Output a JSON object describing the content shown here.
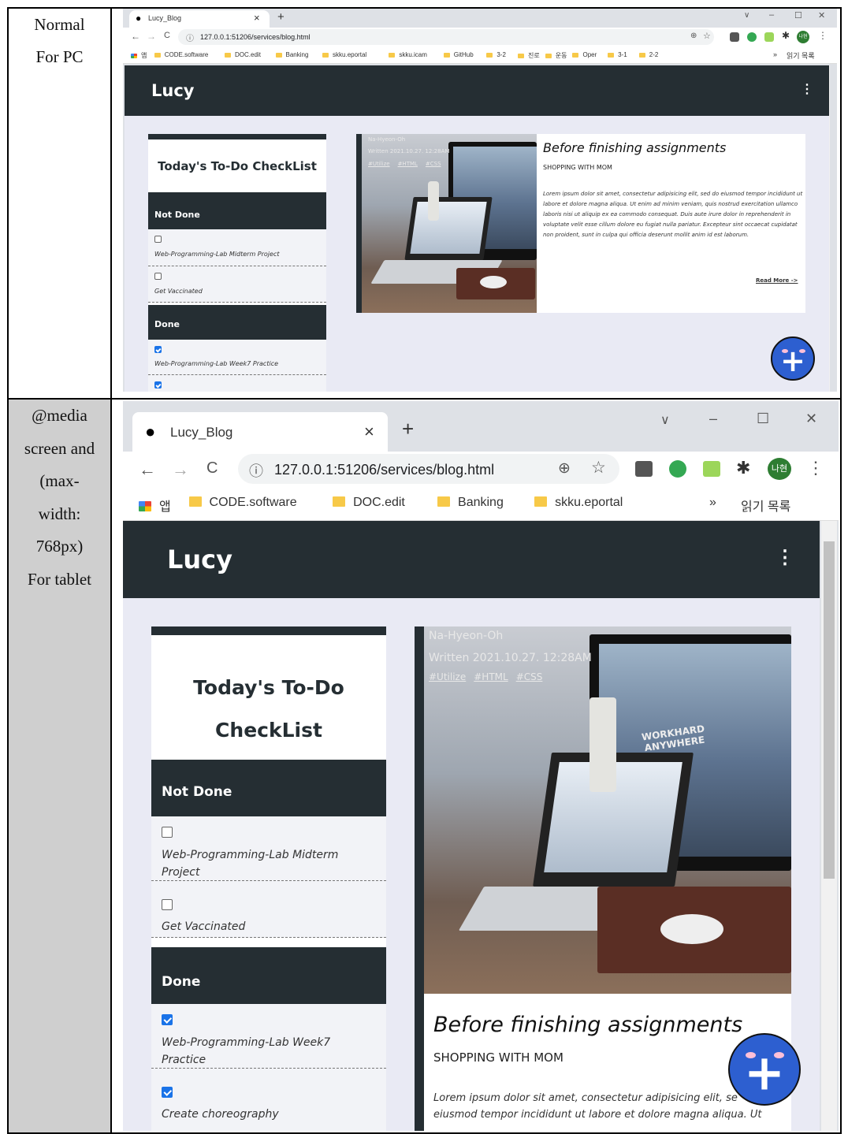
{
  "rows": [
    {
      "label_lines": [
        "Normal",
        "For PC"
      ]
    },
    {
      "label_lines": [
        "@media",
        "screen and",
        "(max-",
        "width:",
        "768px)",
        "For tablet"
      ]
    }
  ],
  "browser": {
    "tab_title": "Lucy_Blog",
    "tab_close": "×",
    "new_tab": "+",
    "controls": {
      "dropdown": "∨",
      "minimize": "–",
      "maximize": "☐",
      "close": "✕"
    },
    "nav": {
      "back": "←",
      "forward": "→",
      "reload": "C",
      "info": "ⓘ"
    },
    "url": "127.0.0.1:51206/services/blog.html",
    "zoom_icon": "⊕",
    "star_icon": "☆",
    "puzzle_icon": "✱",
    "menu_icon": "⋮",
    "profile": "나현",
    "bookmarks_pc": [
      "앱",
      "CODE.software",
      "DOC.edit",
      "Banking",
      "skku.eportal",
      "skku.icam",
      "GitHub",
      "3-2",
      "진로",
      "운동",
      "Oper",
      "3-1",
      "2-2"
    ],
    "bookmarks_tablet": [
      "앱",
      "CODE.software",
      "DOC.edit",
      "Banking",
      "skku.eportal"
    ],
    "more": "»",
    "reading_list": "읽기 목록",
    "colors": {
      "ext_i": "#555",
      "ext_g": "#34a853",
      "ext_y": "#9cd65a",
      "profile": "#2e7d32"
    }
  },
  "site": {
    "logo": "Lucy",
    "kebab": "⋮",
    "todo": {
      "title": "Today's To-Do CheckList",
      "title_line1": "Today's To-Do",
      "title_line2": "CheckList",
      "not_done_label": "Not Done",
      "done_label": "Done",
      "not_done": [
        {
          "text": "Web-Programming-Lab Midterm Project",
          "checked": false
        },
        {
          "text": "Get Vaccinated",
          "checked": false
        }
      ],
      "done": [
        {
          "text": "Web-Programming-Lab Week7 Practice",
          "checked": true
        },
        {
          "text": "Create choreography",
          "checked": true
        }
      ],
      "nd1_line1": "Web-Programming-Lab Midterm",
      "nd1_line2": "Project",
      "d1_line1": "Web-Programming-Lab Week7",
      "d1_line2": "Practice"
    },
    "post": {
      "author": "Na-Hyeon-Oh",
      "written": "Written 2021.10.27. 12:28AM",
      "written_pc": "Written 2021.10.27. 12:28AM",
      "tags": [
        "#Utilize",
        "#HTML",
        "#CSS"
      ],
      "title": "Before finishing assignments",
      "subtitle": "SHOPPING WITH MOM",
      "body": "Lorem ipsum dolor sit amet, consectetur adipisicing elit, sed do eiusmod tempor incididunt ut labore et dolore magna aliqua. Ut enim ad minim veniam, quis nostrud exercitation ullamco laboris nisi ut aliquip ex ea commodo consequat. Duis aute irure dolor in reprehenderit in voluptate velit esse cillum dolore eu fugiat nulla pariatur. Excepteur sint occaecat cupidatat non proident, sunt in culpa qui officia deserunt mollit anim id est laborum.",
      "body_tablet_l1": "Lorem ipsum dolor sit amet, consectetur adipisicing elit, se",
      "body_tablet_l2": "eiusmod tempor incididunt ut labore et dolore magna aliqua. Ut",
      "read_more": "Read More ->",
      "photo_sign": "WORKHARD ANYWHERE"
    },
    "fab": "+"
  }
}
